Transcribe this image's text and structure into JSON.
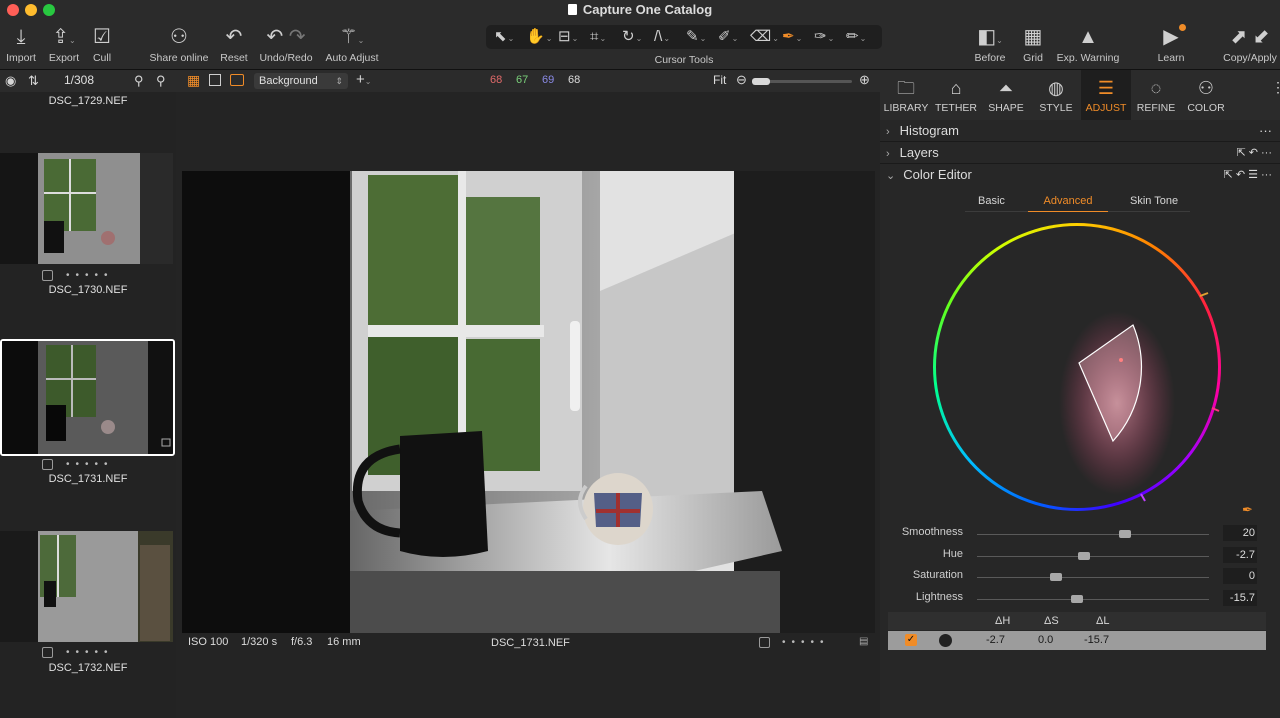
{
  "window": {
    "title": "Capture One Catalog"
  },
  "toolbar": {
    "import": "Import",
    "export": "Export",
    "cull": "Cull",
    "share_online": "Share online",
    "reset": "Reset",
    "undo_redo": "Undo/Redo",
    "auto_adjust": "Auto Adjust",
    "cursor_tools": "Cursor Tools",
    "before": "Before",
    "grid": "Grid",
    "exp_warning": "Exp. Warning",
    "learn": "Learn",
    "copy_apply": "Copy/Apply"
  },
  "browser": {
    "counter": "1/308",
    "items": [
      {
        "name": "DSC_1729.NEF"
      },
      {
        "name": "DSC_1730.NEF"
      },
      {
        "name": "DSC_1731.NEF",
        "selected": true
      },
      {
        "name": "DSC_1732.NEF"
      }
    ]
  },
  "viewer_header": {
    "layer": "Background",
    "rgb": {
      "r": "68",
      "g": "67",
      "b": "69",
      "l": "68"
    },
    "zoom": "Fit"
  },
  "viewer_footer": {
    "iso": "ISO 100",
    "shutter": "1/320 s",
    "aperture": "f/6.3",
    "focal": "16 mm",
    "filename": "DSC_1731.NEF"
  },
  "tool_tabs": [
    {
      "label": "LIBRARY",
      "icon": "folder-icon"
    },
    {
      "label": "TETHER",
      "icon": "camera-icon"
    },
    {
      "label": "SHAPE",
      "icon": "lens-icon"
    },
    {
      "label": "STYLE",
      "icon": "style-icon"
    },
    {
      "label": "ADJUST",
      "icon": "sliders-icon",
      "active": true
    },
    {
      "label": "REFINE",
      "icon": "refine-icon"
    },
    {
      "label": "COLOR",
      "icon": "color-circles-icon"
    }
  ],
  "panel": {
    "histogram": "Histogram",
    "layers": "Layers",
    "color_editor": "Color Editor",
    "tabs": {
      "basic": "Basic",
      "advanced": "Advanced",
      "skin_tone": "Skin Tone"
    },
    "sliders": [
      {
        "label": "Smoothness",
        "value": "20",
        "pos": 0.64
      },
      {
        "label": "Hue",
        "value": "-2.7",
        "pos": 0.46
      },
      {
        "label": "Saturation",
        "value": "0",
        "pos": 0.34
      },
      {
        "label": "Lightness",
        "value": "-15.7",
        "pos": 0.43
      }
    ],
    "table_headers": {
      "dh": "ΔH",
      "ds": "ΔS",
      "dl": "ΔL"
    },
    "table_row": {
      "dh": "-2.7",
      "ds": "0.0",
      "dl": "-15.7"
    }
  },
  "colors": {
    "accent": "#f08c28",
    "selected_border": "#ffffff"
  }
}
